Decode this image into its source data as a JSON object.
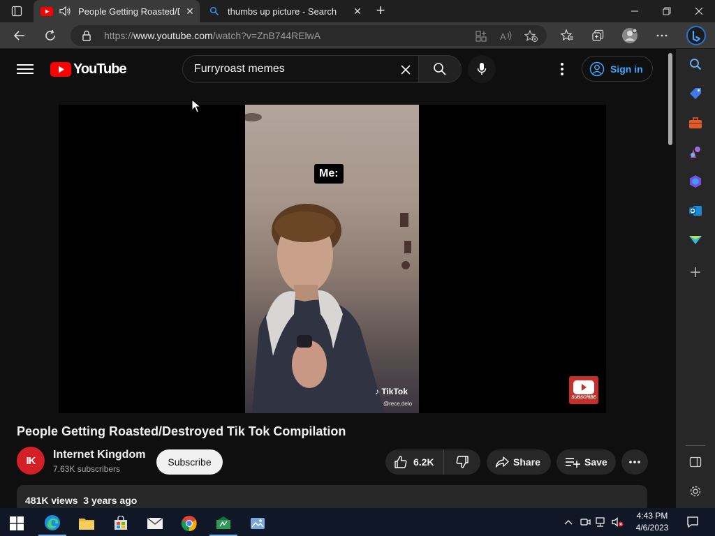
{
  "browser": {
    "tabs": [
      {
        "title": "People Getting Roasted/Destroyed Tik Tok Compilation",
        "active": true,
        "icon": "youtube-icon",
        "audio": true
      },
      {
        "title": "thumbs up picture - Search",
        "active": false,
        "icon": "bing-search-icon",
        "audio": false
      }
    ],
    "url_prefix": "https://",
    "url_host": "www.youtube.com",
    "url_path": "/watch?v=ZnB744RElwA",
    "colors": {
      "tabstrip": "#1f1f1f",
      "toolbar": "#3a3a3a",
      "omnibox": "#2a2a2a"
    }
  },
  "youtube": {
    "logo_text": "YouTube",
    "search_query": "Furryroast memes",
    "sign_in_label": "Sign in",
    "video": {
      "caption": "Me:",
      "watermark_brand": "TikTok",
      "watermark_handle": "@rece.delo",
      "subscribe_watermark": "SUBSCRIBE"
    },
    "title": "People Getting Roasted/Destroyed Tik Tok Compilation",
    "channel": {
      "avatar_text": "IK",
      "name": "Internet Kingdom",
      "subscribers": "7.63K subscribers"
    },
    "subscribe_label": "Subscribe",
    "likes": "6.2K",
    "share_label": "Share",
    "save_label": "Save",
    "description_meta": "481K views  3 years ago",
    "colors": {
      "background": "#0f0f0f",
      "brand_red": "#ff0000",
      "link_blue": "#3ea6ff",
      "pill": "#272727"
    }
  },
  "taskbar": {
    "time": "4:43 PM",
    "date": "4/6/2023",
    "apps": [
      "windows-start-icon",
      "edge-icon",
      "file-explorer-icon",
      "store-icon",
      "mail-icon",
      "chrome-icon",
      "app-icon",
      "photos-icon"
    ]
  }
}
